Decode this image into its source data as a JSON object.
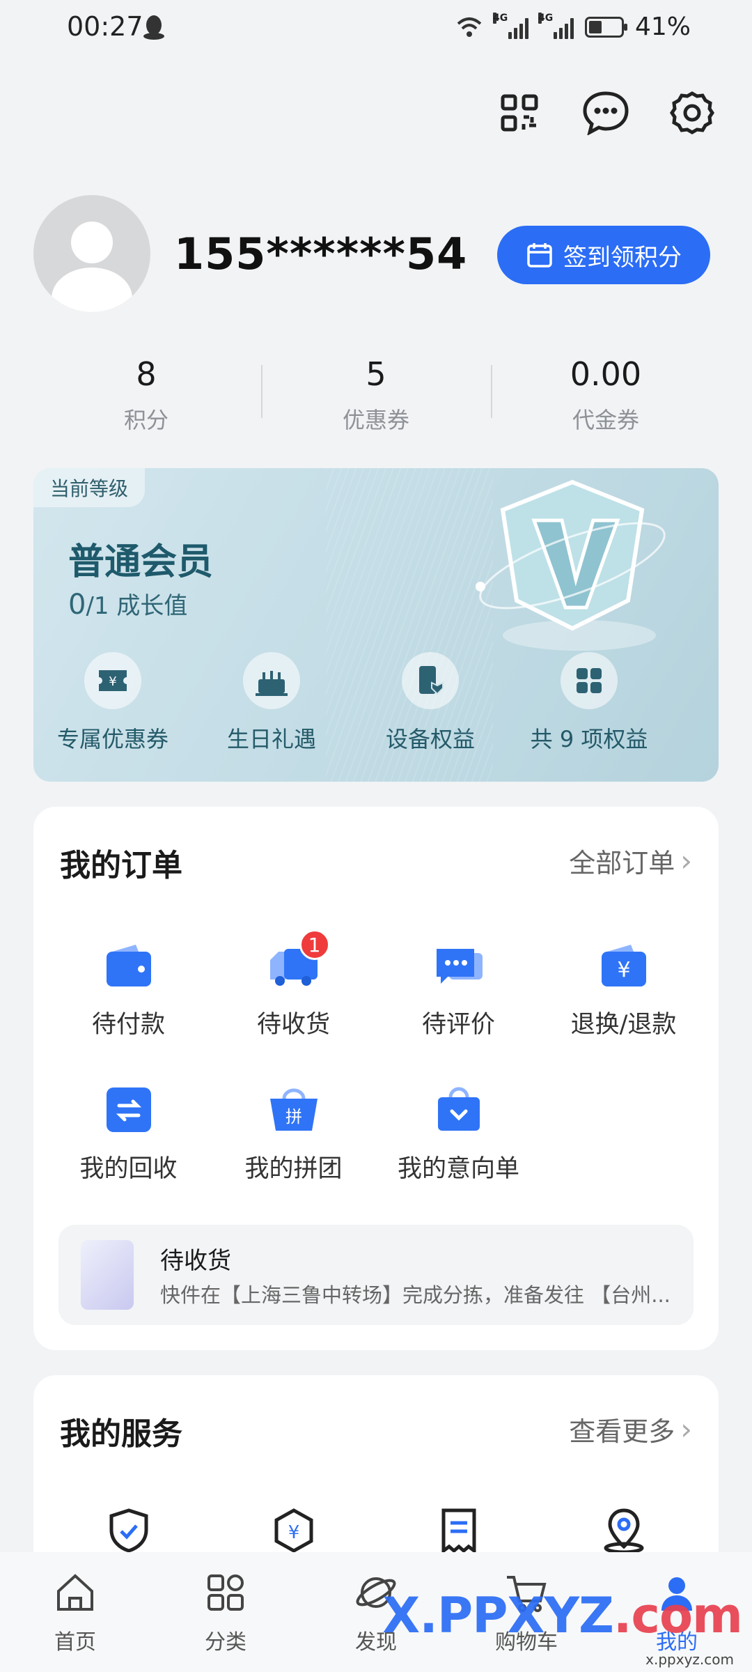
{
  "status": {
    "time": "00:27",
    "battery": "41%",
    "battery_level": 0.41,
    "net1": "4G",
    "net2": "4G"
  },
  "header": {
    "icons": [
      "qr-code-icon",
      "message-icon",
      "settings-icon"
    ]
  },
  "profile": {
    "phone": "155******54",
    "checkin_label": "签到领积分"
  },
  "stats": [
    {
      "value": "8",
      "label": "积分"
    },
    {
      "value": "5",
      "label": "优惠券"
    },
    {
      "value": "0.00",
      "label": "代金券"
    }
  ],
  "member": {
    "tag": "当前等级",
    "level": "普通会员",
    "growth_value": "0",
    "growth_rest": "/1 成长值",
    "perks": [
      {
        "label": "专属优惠券",
        "icon": "coupon-icon"
      },
      {
        "label": "生日礼遇",
        "icon": "cake-icon"
      },
      {
        "label": "设备权益",
        "icon": "device-icon"
      },
      {
        "label": "共 9 项权益",
        "icon": "grid-icon"
      }
    ]
  },
  "orders": {
    "title": "我的订单",
    "more": "全部订单",
    "items": [
      {
        "label": "待付款",
        "icon": "wallet-icon"
      },
      {
        "label": "待收货",
        "icon": "truck-icon",
        "badge": "1"
      },
      {
        "label": "待评价",
        "icon": "comment-icon"
      },
      {
        "label": "退换/退款",
        "icon": "refund-icon"
      },
      {
        "label": "我的回收",
        "icon": "recycle-icon"
      },
      {
        "label": "我的拼团",
        "icon": "group-buy-icon"
      },
      {
        "label": "我的意向单",
        "icon": "wishlist-icon"
      }
    ],
    "tracking": {
      "title": "待收货",
      "desc": "快件在【上海三鲁中转场】完成分拣，准备发往 【台州..."
    }
  },
  "services": {
    "title": "我的服务",
    "more": "查看更多",
    "icons": [
      "shield-check-icon",
      "yuan-hexagon-icon",
      "receipt-icon",
      "location-pin-icon"
    ]
  },
  "tabbar": [
    {
      "label": "首页",
      "icon": "home-icon"
    },
    {
      "label": "分类",
      "icon": "category-icon"
    },
    {
      "label": "发现",
      "icon": "discover-icon"
    },
    {
      "label": "购物车",
      "icon": "cart-icon"
    },
    {
      "label": "我的",
      "icon": "profile-icon",
      "active": true
    }
  ],
  "watermark": {
    "text": ".com",
    "prefix": "X.PPXYZ",
    "sub": "x.ppxyz.com"
  },
  "colors": {
    "accent": "#2b6df5",
    "badge": "#ef3b3b",
    "page_bg": "#f1f3f5"
  }
}
